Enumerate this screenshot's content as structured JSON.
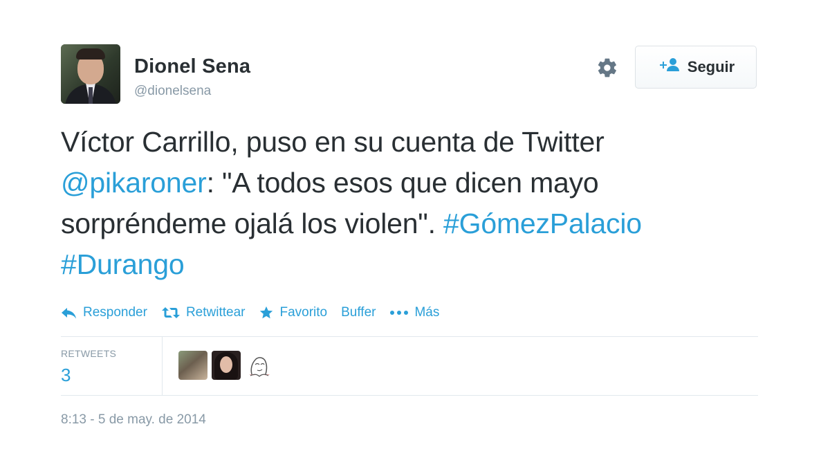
{
  "user": {
    "name": "Dionel Sena",
    "handle": "@dionelsena"
  },
  "follow_button": {
    "label": "Seguir",
    "icon": "add-user-icon"
  },
  "settings_icon": "gear-icon",
  "tweet": {
    "segments": [
      {
        "text": "Víctor Carrillo, puso en su cuenta de Twitter ",
        "type": "text"
      },
      {
        "text": "@pikaroner",
        "type": "mention"
      },
      {
        "text": ": \"A todos esos que dicen mayo sorpréndeme ojalá los violen\". ",
        "type": "text"
      },
      {
        "text": "#GómezPalacio",
        "type": "hashtag"
      },
      {
        "text": " ",
        "type": "text"
      },
      {
        "text": "#Durango",
        "type": "hashtag"
      }
    ]
  },
  "actions": {
    "reply": "Responder",
    "retweet": "Retwittear",
    "favorite": "Favorito",
    "buffer": "Buffer",
    "more": "Más"
  },
  "stats": {
    "retweets_label": "RETWEETS",
    "retweets_count": "3"
  },
  "timestamp": "8:13 - 5 de may. de 2014",
  "colors": {
    "link": "#2a9fd8",
    "text": "#292f33",
    "muted": "#8899a6",
    "border": "#e1e8ed"
  }
}
